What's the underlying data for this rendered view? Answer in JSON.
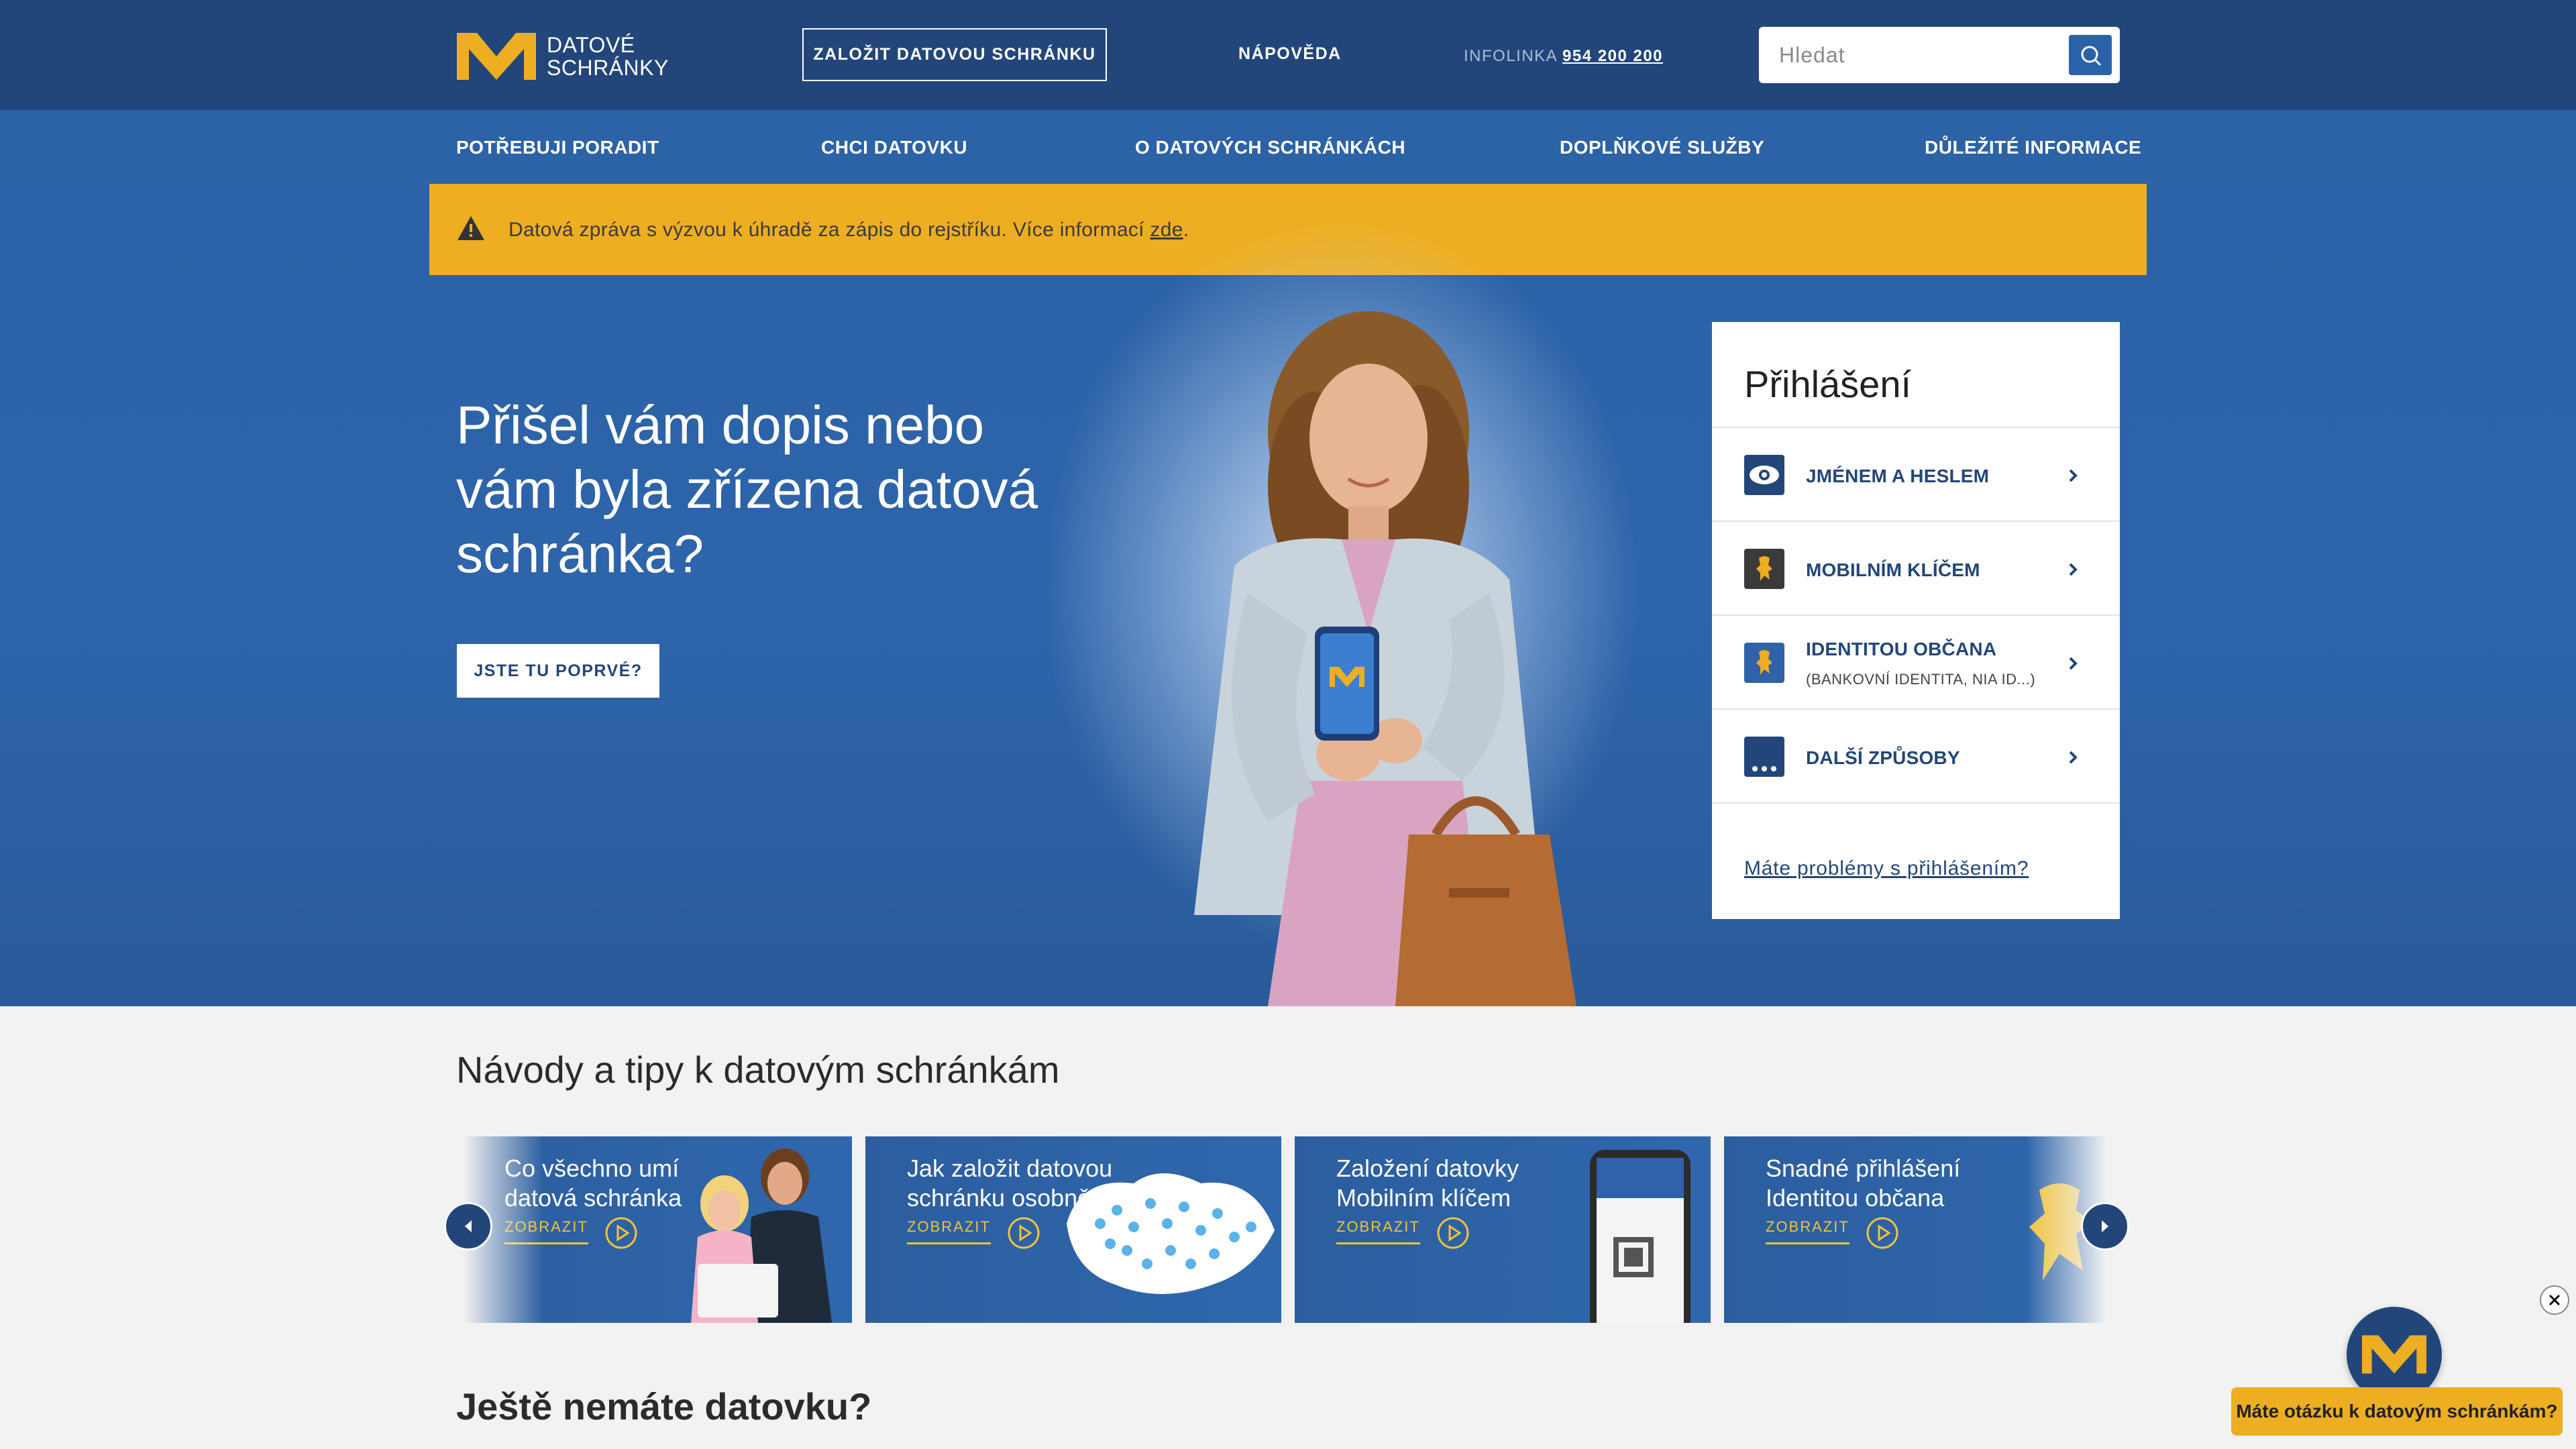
{
  "header": {
    "logo_line1": "DATOVÉ",
    "logo_line2": "SCHRÁNKY",
    "create_button": "ZALOŽIT DATOVOU SCHRÁNKU",
    "help_link": "NÁPOVĚDA",
    "infoline_label": "INFOLINKA",
    "infoline_number": "954 200 200",
    "search_placeholder": "Hledat"
  },
  "nav": {
    "items": [
      {
        "label": "POTŘEBUJI PORADIT"
      },
      {
        "label": "CHCI DATOVKU"
      },
      {
        "label": "O DATOVÝCH SCHRÁNKÁCH"
      },
      {
        "label": "DOPLŇKOVÉ SLUŽBY"
      },
      {
        "label": "DŮLEŽITÉ INFORMACE"
      }
    ]
  },
  "notice": {
    "text": "Datová zpráva s výzvou k úhradě za zápis do rejstříku. Více informací",
    "link": "zde",
    "suffix": ".",
    "color": "#edae22"
  },
  "hero": {
    "headline": "Přišel vám dopis nebo vám byla zřízena datová schránka?",
    "button": "JSTE TU POPRVÉ?"
  },
  "login": {
    "title": "Přihlášení",
    "options": [
      {
        "label": "JMÉNEM A HESLEM",
        "sub": "",
        "icon": "eye-icon"
      },
      {
        "label": "MOBILNÍM KLÍČEM",
        "sub": "",
        "icon": "lion-icon"
      },
      {
        "label": "IDENTITOU OBČANA",
        "sub": "(BANKOVNÍ IDENTITA, NIA ID...)",
        "icon": "lion-icon"
      },
      {
        "label": "DALŠÍ ZPŮSOBY",
        "sub": "",
        "icon": "dots-icon"
      }
    ],
    "problem_link": "Máte problémy s přihlášením?"
  },
  "tips": {
    "title": "Návody a tipy k datovým schránkám",
    "cards": [
      {
        "title": "Co všechno umí datová schránka",
        "action": "ZOBRAZIT"
      },
      {
        "title": "Jak založit datovou schránku osobně",
        "action": "ZOBRAZIT"
      },
      {
        "title": "Založení datovky Mobilním klíčem",
        "action": "ZOBRAZIT"
      },
      {
        "title": "Snadné přihlášení Identitou občana",
        "action": "ZOBRAZIT"
      }
    ]
  },
  "second_section": {
    "title": "Ještě nemáte datovku?"
  },
  "chat": {
    "label": "Máte otázku k datovým schránkám?"
  },
  "colors": {
    "header": "#23467a",
    "hero": "#2c62a6",
    "accent_yellow": "#edae22",
    "link_blue": "#23467a"
  }
}
